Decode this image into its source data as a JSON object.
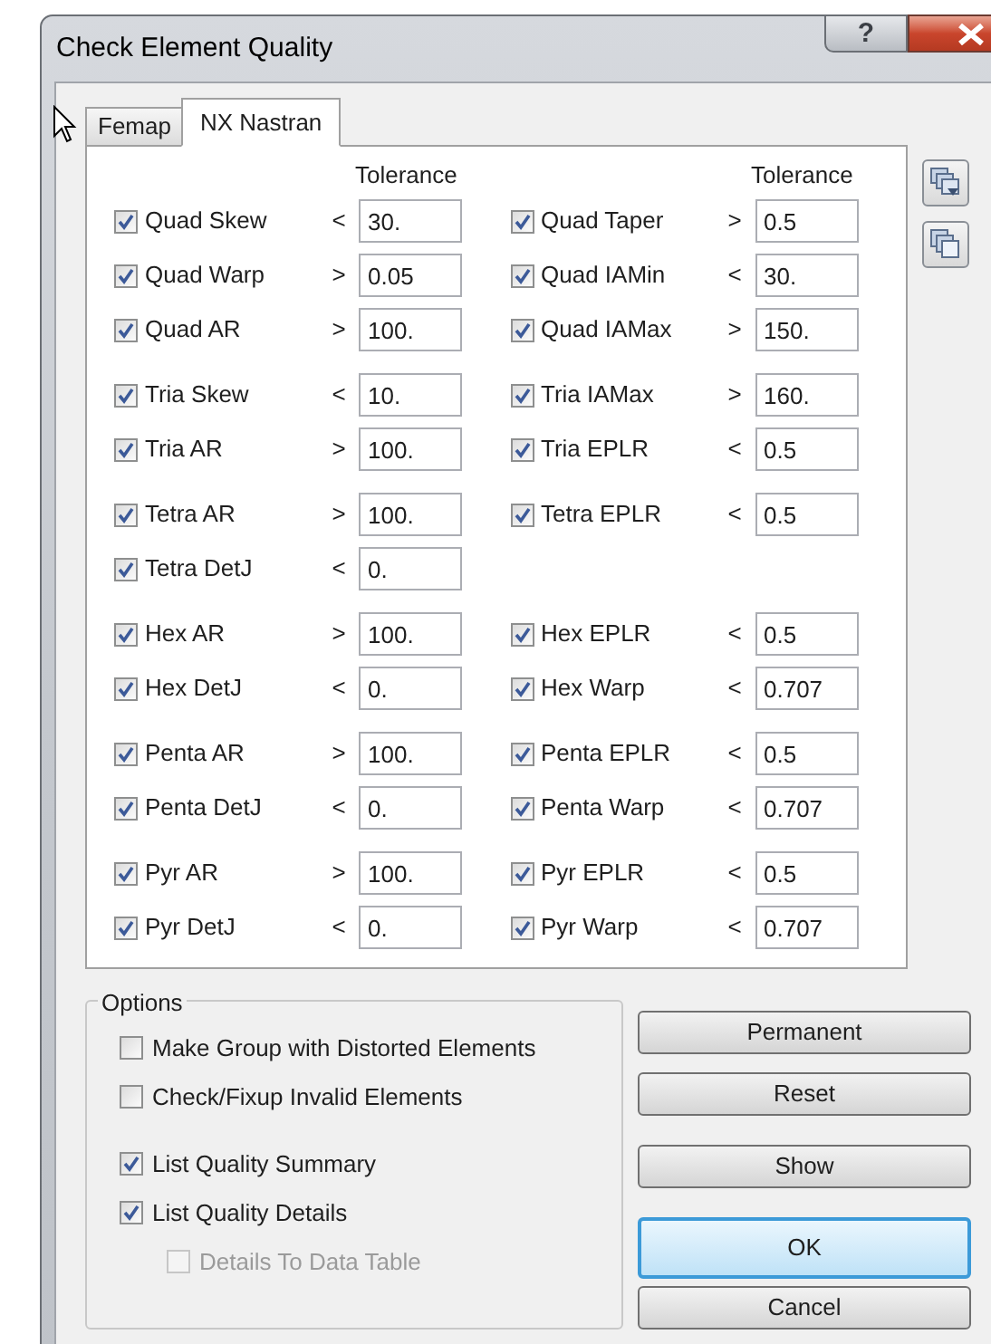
{
  "window": {
    "title": "Check Element Quality",
    "help_button": "?"
  },
  "tabs": [
    {
      "label": "Femap",
      "selected": false
    },
    {
      "label": "NX Nastran",
      "selected": true
    }
  ],
  "column_headers": [
    "Tolerance",
    "Tolerance"
  ],
  "groups": [
    {
      "rows": [
        [
          {
            "label": "Quad Skew",
            "checked": true,
            "op": "<",
            "value": "30."
          },
          {
            "label": "Quad Taper",
            "checked": true,
            "op": ">",
            "value": "0.5"
          }
        ],
        [
          {
            "label": "Quad Warp",
            "checked": true,
            "op": ">",
            "value": "0.05"
          },
          {
            "label": "Quad IAMin",
            "checked": true,
            "op": "<",
            "value": "30."
          }
        ],
        [
          {
            "label": "Quad AR",
            "checked": true,
            "op": ">",
            "value": "100."
          },
          {
            "label": "Quad IAMax",
            "checked": true,
            "op": ">",
            "value": "150."
          }
        ]
      ]
    },
    {
      "rows": [
        [
          {
            "label": "Tria Skew",
            "checked": true,
            "op": "<",
            "value": "10."
          },
          {
            "label": "Tria IAMax",
            "checked": true,
            "op": ">",
            "value": "160."
          }
        ],
        [
          {
            "label": "Tria AR",
            "checked": true,
            "op": ">",
            "value": "100."
          },
          {
            "label": "Tria EPLR",
            "checked": true,
            "op": "<",
            "value": "0.5"
          }
        ]
      ]
    },
    {
      "rows": [
        [
          {
            "label": "Tetra AR",
            "checked": true,
            "op": ">",
            "value": "100."
          },
          {
            "label": "Tetra EPLR",
            "checked": true,
            "op": "<",
            "value": "0.5"
          }
        ],
        [
          {
            "label": "Tetra DetJ",
            "checked": true,
            "op": "<",
            "value": "0."
          }
        ]
      ]
    },
    {
      "rows": [
        [
          {
            "label": "Hex AR",
            "checked": true,
            "op": ">",
            "value": "100."
          },
          {
            "label": "Hex EPLR",
            "checked": true,
            "op": "<",
            "value": "0.5"
          }
        ],
        [
          {
            "label": "Hex DetJ",
            "checked": true,
            "op": "<",
            "value": "0."
          },
          {
            "label": "Hex Warp",
            "checked": true,
            "op": "<",
            "value": "0.707"
          }
        ]
      ]
    },
    {
      "rows": [
        [
          {
            "label": "Penta AR",
            "checked": true,
            "op": ">",
            "value": "100."
          },
          {
            "label": "Penta EPLR",
            "checked": true,
            "op": "<",
            "value": "0.5"
          }
        ],
        [
          {
            "label": "Penta DetJ",
            "checked": true,
            "op": "<",
            "value": "0."
          },
          {
            "label": "Penta Warp",
            "checked": true,
            "op": "<",
            "value": "0.707"
          }
        ]
      ]
    },
    {
      "rows": [
        [
          {
            "label": "Pyr AR",
            "checked": true,
            "op": ">",
            "value": "100."
          },
          {
            "label": "Pyr EPLR",
            "checked": true,
            "op": "<",
            "value": "0.5"
          }
        ],
        [
          {
            "label": "Pyr DetJ",
            "checked": true,
            "op": "<",
            "value": "0."
          },
          {
            "label": "Pyr Warp",
            "checked": true,
            "op": "<",
            "value": "0.707"
          }
        ]
      ]
    }
  ],
  "options": {
    "title": "Options",
    "groups": [
      {
        "items": [
          {
            "label": "Make Group with Distorted Elements",
            "checked": false,
            "disabled": false
          },
          {
            "label": "Check/Fixup Invalid Elements",
            "checked": false,
            "disabled": false
          }
        ]
      },
      {
        "items": [
          {
            "label": "List Quality Summary",
            "checked": true,
            "disabled": false
          },
          {
            "label": "List Quality Details",
            "checked": true,
            "disabled": false,
            "children": [
              {
                "label": "Details To Data Table",
                "checked": false,
                "disabled": true
              }
            ]
          }
        ]
      }
    ]
  },
  "buttons": [
    {
      "label": "Permanent",
      "default": false
    },
    {
      "label": "Reset",
      "default": false
    },
    {
      "label": "Show",
      "default": false
    },
    {
      "label": "OK",
      "default": true
    },
    {
      "label": "Cancel",
      "default": false
    }
  ]
}
